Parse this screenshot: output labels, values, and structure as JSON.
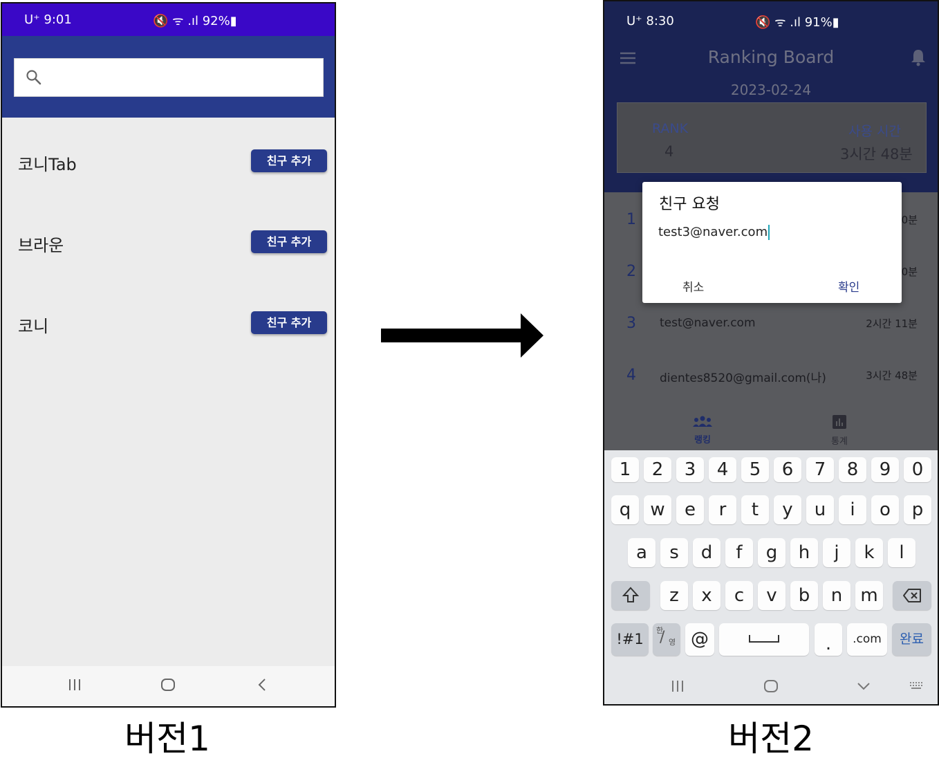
{
  "version1": {
    "caption": "버전1",
    "status": {
      "time": "U⁺ 9:01",
      "right": "🔇 ᯤ .ıl 92%▮"
    },
    "search": {
      "placeholder": ""
    },
    "friends": [
      {
        "name": "코니Tab",
        "button": "친구 추가"
      },
      {
        "name": "브라운",
        "button": "친구 추가"
      },
      {
        "name": "코니",
        "button": "친구 추가"
      }
    ]
  },
  "version2": {
    "caption": "버전2",
    "status": {
      "time": "U⁺ 8:30",
      "right": "🔇 ᯤ .ıl 91%▮"
    },
    "title": "Ranking Board",
    "date": "2023-02-24",
    "card": {
      "rank_label": "RANK",
      "rank_value": "4",
      "time_label": "사용 시간",
      "time_value": "3시간 48분"
    },
    "ranking": [
      {
        "num": "1",
        "email": "",
        "duration": "0분"
      },
      {
        "num": "2",
        "email": "",
        "duration": "0분"
      },
      {
        "num": "3",
        "email": "test@naver.com",
        "duration": "2시간 11분"
      },
      {
        "num": "4",
        "email": "dientes8520@gmail.com(나)",
        "duration": "3시간 48분"
      }
    ],
    "tabs": [
      {
        "label": "랭킹"
      },
      {
        "label": "통계"
      }
    ],
    "dialog": {
      "title": "친구 요청",
      "input_value": "test3@naver.com",
      "cancel": "취소",
      "ok": "확인"
    },
    "keyboard": {
      "numbers": [
        "1",
        "2",
        "3",
        "4",
        "5",
        "6",
        "7",
        "8",
        "9",
        "0"
      ],
      "row1": [
        "q",
        "w",
        "e",
        "r",
        "t",
        "y",
        "u",
        "i",
        "o",
        "p"
      ],
      "row2": [
        "a",
        "s",
        "d",
        "f",
        "g",
        "h",
        "j",
        "k",
        "l"
      ],
      "row3": [
        "z",
        "x",
        "c",
        "v",
        "b",
        "n",
        "m"
      ],
      "symbols_key": "!#1",
      "lang_key_top": "한",
      "lang_key_bottom": "영",
      "at_key": "@",
      "period_key": ".",
      "dotcom_key": ".com",
      "done_key": "완료"
    }
  },
  "colors": {
    "status_purple": "#3a08c7",
    "navy": "#283b8c",
    "dark_navy": "#1a2353"
  }
}
